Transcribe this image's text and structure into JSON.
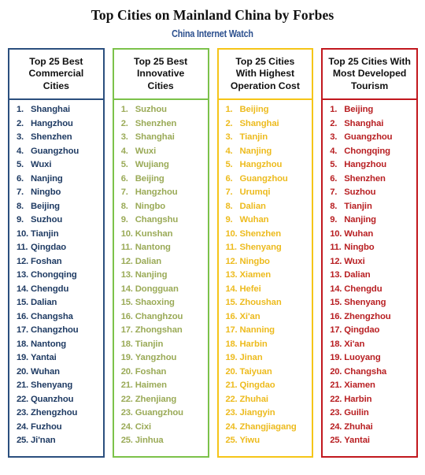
{
  "header": {
    "title": "Top Cities on Mainland China by Forbes",
    "subtitle": "China Internet Watch"
  },
  "colors": {
    "title": "#111111",
    "subtitle": "#2b4f8e",
    "column1_accent": "#2b4f7e",
    "column2_accent": "#7cc24a",
    "column3_accent": "#f5c518",
    "column4_accent": "#c2181e",
    "column1_text": "#1f3b63",
    "column2_text": "#9aaa57",
    "column3_text": "#edbb1e",
    "column4_text": "#b81f22"
  },
  "chart_data": {
    "type": "table",
    "title": "Top Cities on Mainland China by Forbes",
    "subtitle": "China Internet Watch",
    "columns": [
      {
        "header": "Top 25 Best Commercial Cities",
        "header_lines": [
          "Top 25 Best",
          "Commercial",
          "Cities"
        ],
        "accent": "#2b4f7e",
        "ranks": [
          1,
          2,
          3,
          4,
          5,
          6,
          7,
          8,
          9,
          10,
          11,
          12,
          13,
          14,
          15,
          16,
          17,
          18,
          19,
          20,
          21,
          22,
          23,
          24,
          25
        ],
        "cities": [
          "Shanghai",
          "Hangzhou",
          "Shenzhen",
          "Guangzhou",
          "Wuxi",
          "Nanjing",
          "Ningbo",
          "Beijing",
          "Suzhou",
          "Tianjin",
          "Qingdao",
          "Foshan",
          "Chongqing",
          "Chengdu",
          "Dalian",
          "Changsha",
          "Changzhou",
          "Nantong",
          "Yantai",
          "Wuhan",
          "Shenyang",
          "Quanzhou",
          "Zhengzhou",
          "Fuzhou",
          "Ji'nan"
        ]
      },
      {
        "header": "Top 25 Best Innovative Cities",
        "header_lines": [
          "Top 25 Best",
          "Innovative",
          "Cities"
        ],
        "accent": "#7cc24a",
        "ranks": [
          1,
          2,
          3,
          4,
          5,
          6,
          7,
          8,
          9,
          10,
          11,
          12,
          13,
          14,
          15,
          16,
          17,
          18,
          19,
          20,
          21,
          22,
          23,
          24,
          25
        ],
        "cities": [
          "Suzhou",
          "Shenzhen",
          "Shanghai",
          "Wuxi",
          "Wujiang",
          "Beijing",
          "Hangzhou",
          "Ningbo",
          "Changshu",
          "Kunshan",
          "Nantong",
          "Dalian",
          "Nanjing",
          "Dongguan",
          "Shaoxing",
          "Changhzou",
          "Zhongshan",
          "Tianjin",
          "Yangzhou",
          "Foshan",
          "Haimen",
          "Zhenjiang",
          "Guangzhou",
          "Cixi",
          "Jinhua"
        ]
      },
      {
        "header": "Top 25 Cities With Highest Operation Cost",
        "header_lines": [
          "Top 25 Cities",
          "With Highest",
          "Operation Cost"
        ],
        "accent": "#f5c518",
        "ranks": [
          1,
          2,
          3,
          4,
          5,
          6,
          7,
          8,
          9,
          10,
          11,
          12,
          13,
          14,
          15,
          16,
          17,
          18,
          19,
          20,
          21,
          22,
          23,
          24,
          25
        ],
        "cities": [
          "Beijing",
          "Shanghai",
          "Tianjin",
          "Nanjing",
          "Hangzhou",
          "Guangzhou",
          "Urumqi",
          "Dalian",
          "Wuhan",
          "Shenzhen",
          "Shenyang",
          "Ningbo",
          "Xiamen",
          "Hefei",
          "Zhoushan",
          "Xi'an",
          "Nanning",
          "Harbin",
          "Jinan",
          "Taiyuan",
          "Qingdao",
          "Zhuhai",
          "Jiangyin",
          "Zhangjiagang",
          "Yiwu"
        ]
      },
      {
        "header": "Top 25 Cities With Most Developed Tourism",
        "header_lines": [
          "Top 25 Cities With",
          "Most Developed",
          "Tourism"
        ],
        "accent": "#c2181e",
        "ranks": [
          1,
          2,
          3,
          4,
          5,
          6,
          7,
          8,
          9,
          10,
          11,
          12,
          13,
          14,
          15,
          16,
          17,
          18,
          19,
          20,
          21,
          22,
          23,
          24,
          25
        ],
        "cities": [
          "Beijing",
          "Shanghai",
          "Guangzhou",
          "Chongqing",
          "Hangzhou",
          "Shenzhen",
          "Suzhou",
          "Tianjin",
          "Nanjing",
          "Wuhan",
          "Ningbo",
          "Wuxi",
          "Dalian",
          "Chengdu",
          "Shenyang",
          "Zhengzhou",
          "Qingdao",
          "Xi'an",
          "Luoyang",
          "Changsha",
          "Xiamen",
          "Harbin",
          "Guilin",
          "Zhuhai",
          "Yantai"
        ]
      }
    ]
  }
}
